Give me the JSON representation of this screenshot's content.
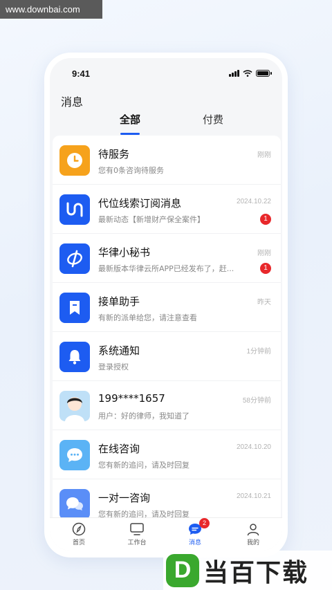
{
  "watermark": {
    "site": "www.downbai.com",
    "brand": "当百下载",
    "brand_letter": "D"
  },
  "status_bar": {
    "time": "9:41"
  },
  "header": {
    "title": "消息"
  },
  "tabs": [
    {
      "label": "全部",
      "active": true
    },
    {
      "label": "付费",
      "active": false
    }
  ],
  "messages": [
    {
      "name": "待服务",
      "preview": "您有0条咨询待服务",
      "time": "刚刚",
      "badge": "",
      "icon": "clock-icon",
      "color": "#f6a21c"
    },
    {
      "name": "代位线索订阅消息",
      "preview": "最新动态【新增财产保全案件】",
      "time": "2024.10.22",
      "badge": "1",
      "icon": "subscription-logo-icon",
      "color": "#1d5cf1"
    },
    {
      "name": "华律小秘书",
      "preview": "最新版本华律云所APP已经发布了，赶...",
      "time": "刚刚",
      "badge": "1",
      "icon": "hualv-logo-icon",
      "color": "#1d5cf1"
    },
    {
      "name": "接单助手",
      "preview": "有新的派单给您，请注意查看",
      "time": "昨天",
      "badge": "",
      "icon": "bookmark-icon",
      "color": "#1d5cf1"
    },
    {
      "name": "系统通知",
      "preview": "登录授权",
      "time": "1分钟前",
      "badge": "",
      "icon": "bell-icon",
      "color": "#1d5cf1"
    },
    {
      "name": "199****1657",
      "preview": "用户：好的律师，我知道了",
      "time": "58分钟前",
      "badge": "",
      "icon": "user-avatar",
      "color": "#bfe0f7"
    },
    {
      "name": "在线咨询",
      "preview": "您有新的追问，请及时回复",
      "time": "2024.10.20",
      "badge": "",
      "icon": "chat-bubble-icon",
      "color": "#5bb3f5"
    },
    {
      "name": "一对一咨询",
      "preview": "您有新的追问，请及时回复",
      "time": "2024.10.21",
      "badge": "",
      "icon": "chat-bubbles-icon",
      "color": "#5a8ef7"
    }
  ],
  "tabbar": [
    {
      "label": "首页",
      "icon": "compass-icon"
    },
    {
      "label": "工作台",
      "icon": "monitor-icon"
    },
    {
      "label": "消息",
      "icon": "message-icon",
      "badge": "2"
    },
    {
      "label": "我的",
      "icon": "person-icon"
    }
  ],
  "colors": {
    "accent": "#1d5cf1",
    "badge": "#e8282b"
  }
}
